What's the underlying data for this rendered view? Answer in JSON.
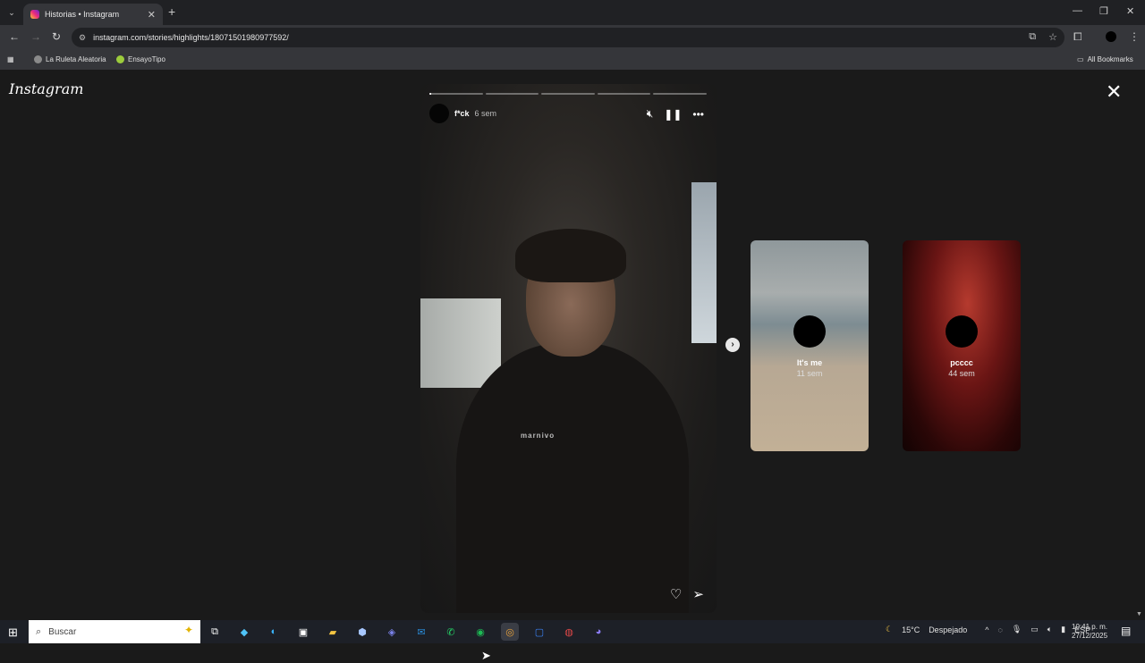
{
  "browser": {
    "tab_title": "Historias • Instagram",
    "tab_close": "✕",
    "new_tab": "+",
    "url": "instagram.com/stories/highlights/18071501980977592/",
    "bookmarks": [
      {
        "label": "La Ruleta Aleatoria",
        "color": "#8a8a8a"
      },
      {
        "label": "EnsayoTipo",
        "color": "#9ccc3c"
      }
    ],
    "all_bookmarks": "All Bookmarks"
  },
  "instagram": {
    "logo": "Instagram",
    "close": "✕",
    "story": {
      "username": "f*ck",
      "time": "6 sem",
      "shirt_text": "marnivo",
      "progress_total": 5,
      "progress_current": 0,
      "progress_current_fill": 0.03
    },
    "previews": [
      {
        "name": "It's me",
        "time": "11 sem"
      },
      {
        "name": "pcccc",
        "time": "44 sem"
      }
    ]
  },
  "taskbar": {
    "search_placeholder": "Buscar",
    "weather_temp": "15°C",
    "weather_text": "Despejado",
    "lang": "ESP",
    "time": "10:41 p. m.",
    "date": "27/12/2025"
  }
}
